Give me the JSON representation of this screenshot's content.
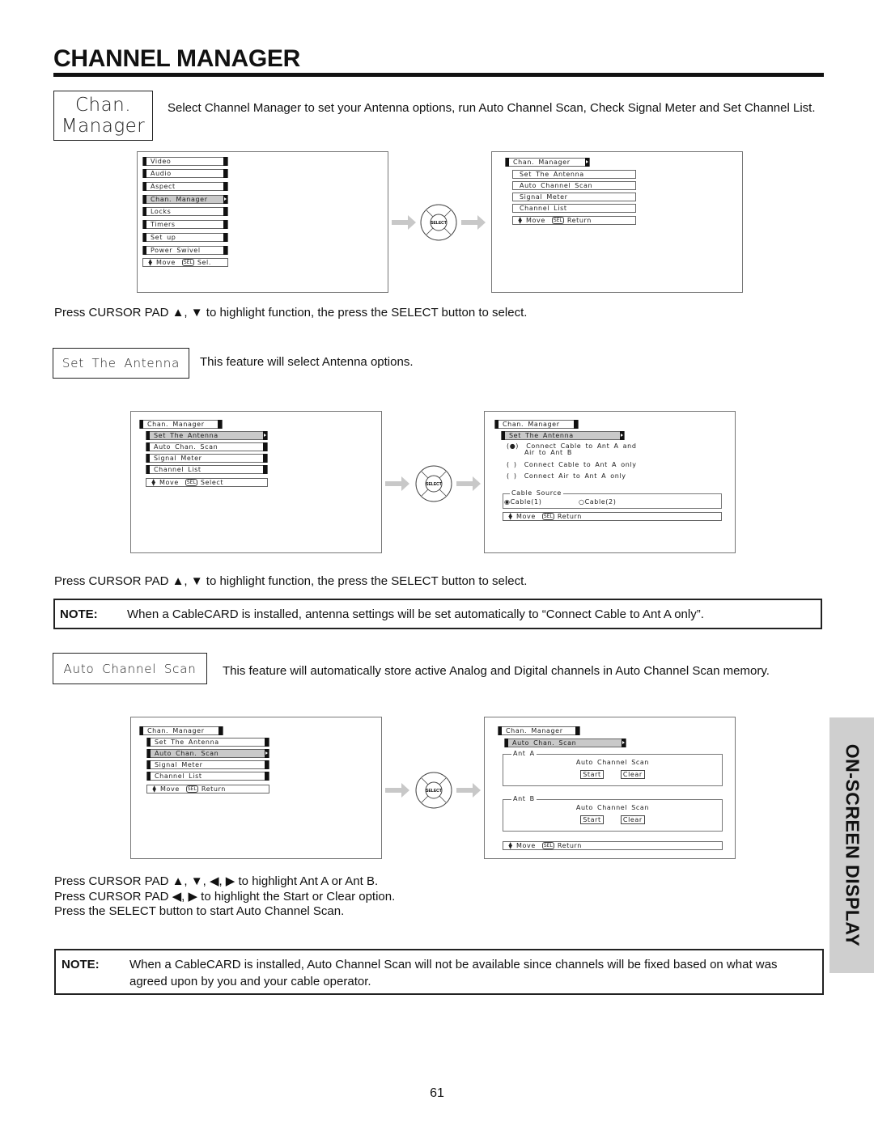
{
  "header": {
    "title": "CHANNEL MANAGER"
  },
  "intro": {
    "label_line1": "Chan.",
    "label_line2": "Manager",
    "description": "Select Channel Manager to set your Antenna options, run Auto Channel Scan, Check Signal Meter and Set Channel List."
  },
  "figure1": {
    "main_menu": {
      "items": [
        "Video",
        "Audio",
        "Aspect",
        "Chan. Manager",
        "Locks",
        "Timers",
        "Set up",
        "Power Swivel"
      ],
      "selected": "Chan. Manager",
      "nav": {
        "move": "Move",
        "sel_chip": "SEL",
        "action": "Sel."
      }
    },
    "submenu": {
      "header": "Chan. Manager",
      "items": [
        "Set The Antenna",
        "Auto Channel Scan",
        "Signal Meter",
        "Channel List"
      ],
      "nav": {
        "move": "Move",
        "sel_chip": "SEL",
        "action": "Return"
      }
    },
    "select_pad_label": "SELECT"
  },
  "instruction1": "Press CURSOR PAD ▲, ▼ to highlight function, the press the SELECT button to select.",
  "set_antenna": {
    "label": "Set The Antenna",
    "description": "This feature will select Antenna options."
  },
  "figure2": {
    "left": {
      "header": "Chan. Manager",
      "items": [
        "Set The Antenna",
        "Auto Chan. Scan",
        "Signal Meter",
        "Channel List"
      ],
      "selected": "Set The Antenna",
      "nav": {
        "move": "Move",
        "sel_chip": "SEL",
        "action": "Select"
      }
    },
    "right": {
      "header": "Chan. Manager",
      "selected_item": "Set The Antenna",
      "options": [
        {
          "mark": "(●)",
          "line1": "Connect Cable to Ant A and",
          "line2": "Air to Ant B",
          "selected": true
        },
        {
          "mark": "( )",
          "line1": "Connect Cable to Ant A only",
          "selected": false
        },
        {
          "mark": "( )",
          "line1": "Connect Air to Ant A only",
          "selected": false
        }
      ],
      "cable_source": {
        "legend": "Cable Source",
        "options": [
          {
            "label": "Cable(1)",
            "selected": true
          },
          {
            "label": "Cable(2)",
            "selected": false
          }
        ]
      },
      "nav": {
        "move": "Move",
        "sel_chip": "SEL",
        "action": "Return"
      }
    },
    "select_pad_label": "SELECT"
  },
  "instruction2": "Press CURSOR PAD ▲, ▼ to highlight function, the press the SELECT button to select.",
  "note1": {
    "label": "NOTE:",
    "text": "When a CableCARD is installed, antenna settings will be set automatically to “Connect Cable to Ant A only”."
  },
  "auto_scan": {
    "label": "Auto Channel Scan",
    "description": "This feature will automatically store active Analog and Digital channels in Auto Channel Scan memory."
  },
  "figure3": {
    "left": {
      "header": "Chan. Manager",
      "items": [
        "Set The Antenna",
        "Auto Chan. Scan",
        "Signal Meter",
        "Channel List"
      ],
      "selected": "Auto Chan. Scan",
      "nav": {
        "move": "Move",
        "sel_chip": "SEL",
        "action": "Return"
      }
    },
    "right": {
      "header": "Chan. Manager",
      "selected_item": "Auto Chan. Scan",
      "groups": [
        {
          "legend": "Ant A",
          "title": "Auto Channel Scan",
          "start": "Start",
          "clear": "Clear"
        },
        {
          "legend": "Ant B",
          "title": "Auto Channel Scan",
          "start": "Start",
          "clear": "Clear"
        }
      ],
      "nav": {
        "move": "Move",
        "sel_chip": "SEL",
        "action": "Return"
      }
    },
    "select_pad_label": "SELECT"
  },
  "instructions3": [
    "Press CURSOR PAD ▲, ▼, ◀, ▶ to highlight Ant A or Ant B.",
    "Press CURSOR PAD ◀, ▶ to highlight the Start or Clear option.",
    "Press the SELECT button to start Auto Channel Scan."
  ],
  "note2": {
    "label": "NOTE:",
    "text_line1": "When a CableCARD is installed, Auto Channel Scan will not be available since channels will be fixed based on what was",
    "text_line2": "agreed upon by you and your cable operator."
  },
  "side_tab": "ON-SCREEN DISPLAY",
  "page_number": "61"
}
